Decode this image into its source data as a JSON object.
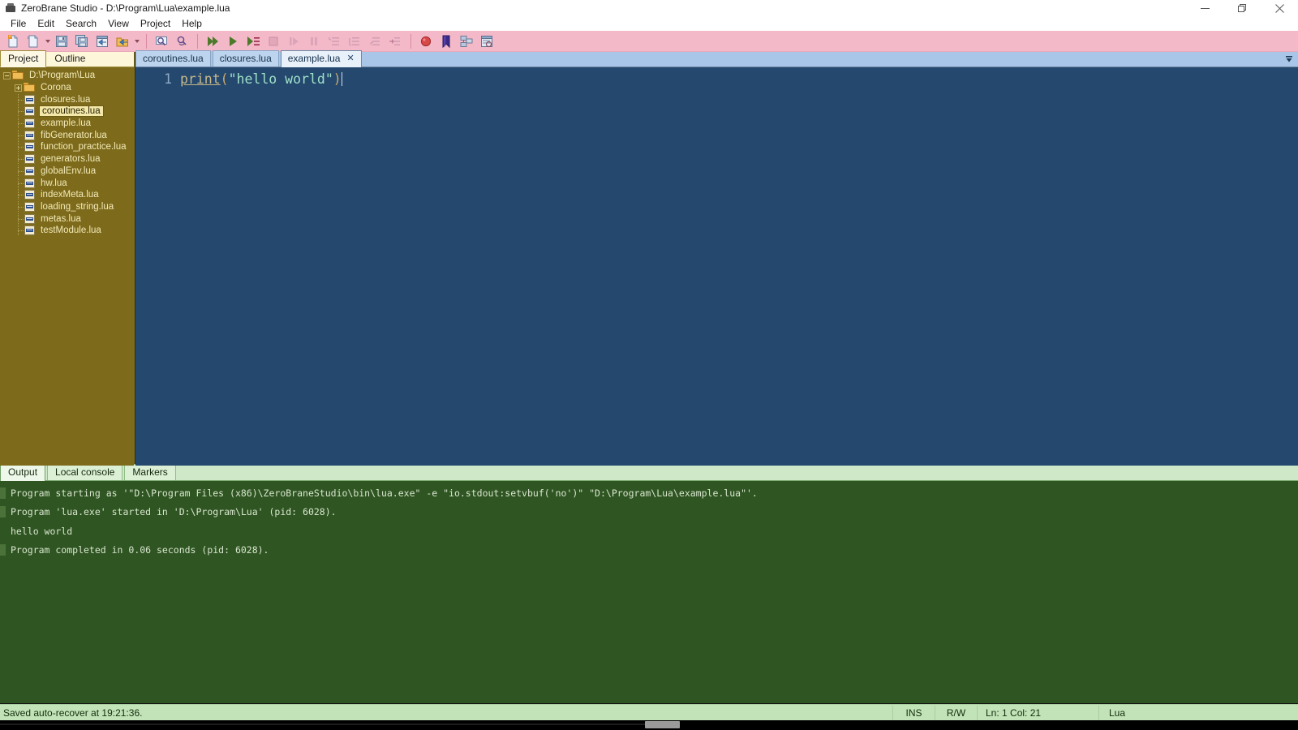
{
  "window": {
    "title": "ZeroBrane Studio - D:\\Program\\Lua\\example.lua",
    "app_icon_name": "zerobrane-app-icon",
    "minimize_label": "—",
    "restore_label": "❐",
    "close_label": "✕"
  },
  "menu": {
    "items": [
      {
        "label": "File"
      },
      {
        "label": "Edit"
      },
      {
        "label": "Search"
      },
      {
        "label": "View"
      },
      {
        "label": "Project"
      },
      {
        "label": "Help"
      }
    ]
  },
  "toolbar": {
    "background": "#f3b9c8",
    "buttons": [
      {
        "name": "new-file-icon",
        "tooltip": "New"
      },
      {
        "name": "open-file-icon",
        "tooltip": "Open"
      },
      {
        "name": "open-file-dropdown-icon",
        "tooltip": "Open recent"
      },
      {
        "name": "save-icon",
        "tooltip": "Save"
      },
      {
        "name": "save-all-icon",
        "tooltip": "Save All"
      },
      {
        "name": "close-file-icon",
        "tooltip": "Close"
      },
      {
        "name": "close-all-icon",
        "tooltip": "Close All"
      },
      {
        "name": "close-all-dropdown-icon",
        "tooltip": "Close options"
      },
      {
        "name": "find-icon",
        "tooltip": "Find"
      },
      {
        "name": "find-replace-icon",
        "tooltip": "Replace"
      },
      {
        "name": "start-debug-icon",
        "tooltip": "Start Debugging"
      },
      {
        "name": "run-icon",
        "tooltip": "Run"
      },
      {
        "name": "run-to-cursor-icon",
        "tooltip": "Run to cursor"
      },
      {
        "name": "stop-icon",
        "tooltip": "Stop"
      },
      {
        "name": "step-over-icon",
        "tooltip": "Step Over"
      },
      {
        "name": "pause-icon",
        "tooltip": "Pause"
      },
      {
        "name": "step-into-icon",
        "tooltip": "Step Into"
      },
      {
        "name": "step-out-icon",
        "tooltip": "Step Out"
      },
      {
        "name": "step-return-icon",
        "tooltip": "Step Return"
      },
      {
        "name": "step-next-icon",
        "tooltip": "Next"
      },
      {
        "name": "breakpoint-icon",
        "tooltip": "Toggle Breakpoint"
      },
      {
        "name": "bookmark-icon",
        "tooltip": "Toggle Bookmark"
      },
      {
        "name": "stack-view-icon",
        "tooltip": "Stack window"
      },
      {
        "name": "watch-view-icon",
        "tooltip": "Watch window"
      }
    ]
  },
  "sidebar": {
    "tabs": [
      {
        "label": "Project",
        "active": true
      },
      {
        "label": "Outline",
        "active": false
      }
    ],
    "tree": [
      {
        "label": "D:\\Program\\Lua",
        "type": "root-folder",
        "depth": 0,
        "expander": "minus",
        "selected": false
      },
      {
        "label": "Corona",
        "type": "folder",
        "depth": 1,
        "expander": "plus",
        "selected": false
      },
      {
        "label": "closures.lua",
        "type": "lua-file",
        "depth": 1,
        "selected": false
      },
      {
        "label": "coroutines.lua",
        "type": "lua-file",
        "depth": 1,
        "selected": true
      },
      {
        "label": "example.lua",
        "type": "lua-file",
        "depth": 1,
        "selected": false
      },
      {
        "label": "fibGenerator.lua",
        "type": "lua-file",
        "depth": 1,
        "selected": false
      },
      {
        "label": "function_practice.lua",
        "type": "lua-file",
        "depth": 1,
        "selected": false
      },
      {
        "label": "generators.lua",
        "type": "lua-file",
        "depth": 1,
        "selected": false
      },
      {
        "label": "globalEnv.lua",
        "type": "lua-file",
        "depth": 1,
        "selected": false
      },
      {
        "label": "hw.lua",
        "type": "lua-file",
        "depth": 1,
        "selected": false
      },
      {
        "label": "indexMeta.lua",
        "type": "lua-file",
        "depth": 1,
        "selected": false
      },
      {
        "label": "loading_string.lua",
        "type": "lua-file",
        "depth": 1,
        "selected": false
      },
      {
        "label": "metas.lua",
        "type": "lua-file",
        "depth": 1,
        "selected": false
      },
      {
        "label": "testModule.lua",
        "type": "lua-file",
        "depth": 1,
        "selected": false
      }
    ]
  },
  "editor": {
    "tabs": [
      {
        "label": "coroutines.lua",
        "active": false,
        "closable": false
      },
      {
        "label": "closures.lua",
        "active": false,
        "closable": false
      },
      {
        "label": "example.lua",
        "active": true,
        "closable": true,
        "close_label": "✕"
      }
    ],
    "tab_overflow_icon": "chevron-down-icon",
    "background": "#24486e",
    "line_number": "1",
    "code": {
      "fn": "print",
      "open_paren": "(",
      "string": "\"hello world\"",
      "close_paren": ")"
    }
  },
  "output": {
    "tabs": [
      {
        "label": "Output",
        "active": true
      },
      {
        "label": "Local console",
        "active": false
      },
      {
        "label": "Markers",
        "active": false
      }
    ],
    "background": "#2f5522",
    "lines": [
      {
        "text": "Program starting as '\"D:\\Program Files (x86)\\ZeroBraneStudio\\bin\\lua.exe\" -e \"io.stdout:setvbuf('no')\" \"D:\\Program\\Lua\\example.lua\"'.",
        "marked": true
      },
      {
        "text": "Program 'lua.exe' started in 'D:\\Program\\Lua' (pid: 6028).",
        "marked": true
      },
      {
        "text": "hello world",
        "marked": false
      },
      {
        "text": "Program completed in 0.06 seconds (pid: 6028).",
        "marked": true
      }
    ]
  },
  "statusbar": {
    "message": "Saved auto-recover at 19:21:36.",
    "insert_mode": "INS",
    "readwrite": "R/W",
    "cursor": "Ln: 1 Col: 21",
    "language": "Lua"
  }
}
